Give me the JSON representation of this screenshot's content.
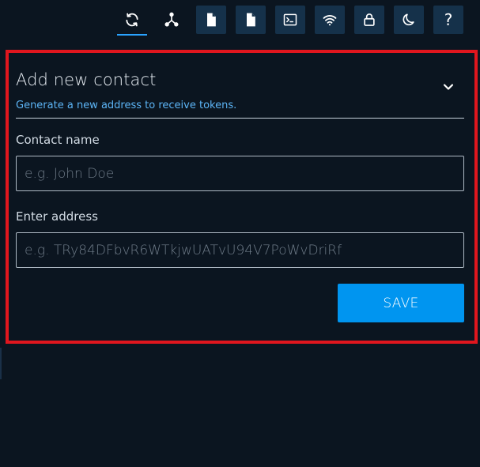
{
  "toolbar": {
    "buttons": [
      {
        "name": "refresh-icon",
        "active": true
      },
      {
        "name": "network-icon",
        "active": false
      },
      {
        "name": "document-icon",
        "active": false
      },
      {
        "name": "document-icon",
        "active": false
      },
      {
        "name": "terminal-icon",
        "active": false
      },
      {
        "name": "wifi-icon",
        "active": false
      },
      {
        "name": "lock-icon",
        "active": false
      },
      {
        "name": "moon-icon",
        "active": false
      },
      {
        "name": "help-icon",
        "active": false
      }
    ],
    "help_label": "?"
  },
  "panel": {
    "title": "Add new contact",
    "subtitle": "Generate a new address to receive tokens.",
    "contact_name": {
      "label": "Contact name",
      "value": "",
      "placeholder": "e.g. John Doe"
    },
    "address": {
      "label": "Enter address",
      "value": "",
      "placeholder": "e.g. TRy84DFbvR6WTkjwUATvU94V7PoWvDriRf"
    },
    "save_label": "SAVE"
  },
  "colors": {
    "background": "#0b1520",
    "toolbar_button": "#15314a",
    "accent": "#0095f0",
    "subtitle": "#5cb4f5",
    "highlight_border": "#e0161e"
  }
}
